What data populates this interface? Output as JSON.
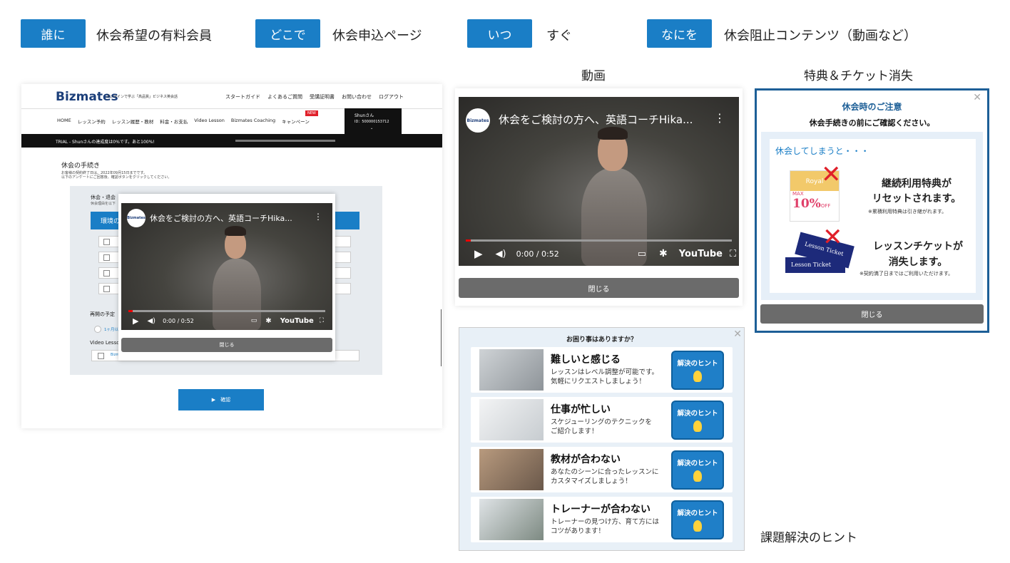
{
  "header": {
    "who": {
      "tag": "誰に",
      "value": "休会希望の有料会員"
    },
    "where": {
      "tag": "どこで",
      "value": "休会申込ページ"
    },
    "when": {
      "tag": "いつ",
      "value": "すぐ"
    },
    "what": {
      "tag": "なにを",
      "value": "休会阻止コンテンツ（動画など）"
    }
  },
  "captions": {
    "video": "動画",
    "benefits": "特典＆チケット消失",
    "hints": "課題解決のヒント"
  },
  "page": {
    "logo": "Bizmates",
    "tagline": "オンラインで学ぶ「高品質」ビジネス英会話",
    "top_nav": [
      "スタートガイド",
      "よくあるご質問",
      "受講証明書",
      "お問い合わせ",
      "ログアウト"
    ],
    "main_nav": [
      "HOME",
      "レッスン予約",
      "レッスン履歴・教材",
      "料金・お支払",
      "Video Lesson",
      "Bizmates Coaching",
      "キャンペーン"
    ],
    "new_badge": "NEW",
    "user_name": "Shunさん",
    "user_id": "ID：500000153712",
    "trial_text": "TRIAL - Shunさんの達成度は0%です。あと100%!",
    "section_title": "休会の手続き",
    "section_sub1": "お客様の契約終了日は、2022年09月15日までです。",
    "section_sub2": "以下のアンケートにご回答後、確認ボタンをクリックしてください。",
    "form_label": "休会・退会",
    "form_sub": "休会理由を以下",
    "env_label": "環境の",
    "resume_label": "再開の予定",
    "resume_option": "1ヶ月以",
    "video_lesson_label": "Video Lesson",
    "video_lesson_item": "Bizm",
    "confirm_button": "▶　確認"
  },
  "video": {
    "title": "休会をご検討の方へ、英語コーチHika...",
    "channel_logo": "Bizmates",
    "time": "0:00 / 0:52",
    "platform": "YouTube",
    "watermark": "Bizmates",
    "close": "閉じる",
    "progress": 0.02
  },
  "benefits_modal": {
    "title": "休会時のご注意",
    "subtitle": "休会手続きの前にご確認ください。",
    "lead": "休会してしまうと・・・",
    "item1_title_l1": "継続利用特典が",
    "item1_title_l2": "リセットされます。",
    "item1_note": "※累積利用特典は引き継がれます。",
    "item1_badge_top": "Royal",
    "item1_badge_max": "MAX",
    "item1_badge_pct": "10%",
    "item1_badge_off": "OFF",
    "item2_title_l1": "レッスンチケットが",
    "item2_title_l2": "消失します。",
    "item2_note": "※契約満了日まではご利用いただけます。",
    "ticket_label": "Lesson Ticket",
    "close": "閉じる"
  },
  "hints_modal": {
    "title": "お困り事はありますか？",
    "button_label": "解決のヒント",
    "rows": [
      {
        "title": "難しいと感じる",
        "desc1": "レッスンはレベル調整が可能です。",
        "desc2": "気軽にリクエストしましょう！"
      },
      {
        "title": "仕事が忙しい",
        "desc1": "スケジューリングのテクニックを",
        "desc2": "ご紹介します！"
      },
      {
        "title": "教材が合わない",
        "desc1": "あなたのシーンに合ったレッスンに",
        "desc2": "カスタマイズしましょう！"
      },
      {
        "title": "トレーナーが合わない",
        "desc1": "トレーナーの見つけ方、育て方には",
        "desc2": "コツがあります！"
      }
    ]
  },
  "colors": {
    "accent": "#1a7ec6",
    "dark_bar": "#111111",
    "close_gray": "#6b6b6b",
    "modal_border": "#1d5f97"
  }
}
